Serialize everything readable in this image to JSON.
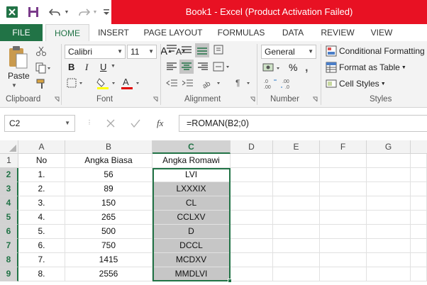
{
  "window": {
    "title": "Book1 - Excel (Product Activation Failed)"
  },
  "tabs": [
    "FILE",
    "HOME",
    "INSERT",
    "PAGE LAYOUT",
    "FORMULAS",
    "DATA",
    "REVIEW",
    "VIEW"
  ],
  "ribbon": {
    "paste_label": "Paste",
    "font_name": "Calibri",
    "font_size": "11",
    "number_format": "General",
    "bold": "B",
    "italic": "I",
    "underline": "U",
    "font_grow": "A",
    "font_shrink": "A",
    "percent": "%",
    "conditional_formatting": "Conditional Formatting",
    "format_as_table": "Format as Table",
    "cell_styles": "Cell Styles",
    "groups": {
      "clipboard": "Clipboard",
      "font": "Font",
      "alignment": "Alignment",
      "number": "Number",
      "styles": "Styles"
    }
  },
  "formula_bar": {
    "name_box": "C2",
    "fx": "fx",
    "formula": "=ROMAN(B2;0)"
  },
  "columns": [
    "A",
    "B",
    "C",
    "D",
    "E",
    "F",
    "G"
  ],
  "rows": [
    [
      "1",
      "No",
      "Angka Biasa",
      "Angka Romawi"
    ],
    [
      "2",
      "1.",
      "56",
      "LVI"
    ],
    [
      "3",
      "2.",
      "89",
      "LXXXIX"
    ],
    [
      "4",
      "3.",
      "150",
      "CL"
    ],
    [
      "5",
      "4.",
      "265",
      "CCLXV"
    ],
    [
      "6",
      "5.",
      "500",
      "D"
    ],
    [
      "7",
      "6.",
      "750",
      "DCCL"
    ],
    [
      "8",
      "7.",
      "1415",
      "MCDXV"
    ],
    [
      "9",
      "8.",
      "2556",
      "MMDLVI"
    ]
  ],
  "colors": {
    "excel_green": "#217346",
    "title_red": "#e81123",
    "selection_gray": "#c6c6c6"
  }
}
